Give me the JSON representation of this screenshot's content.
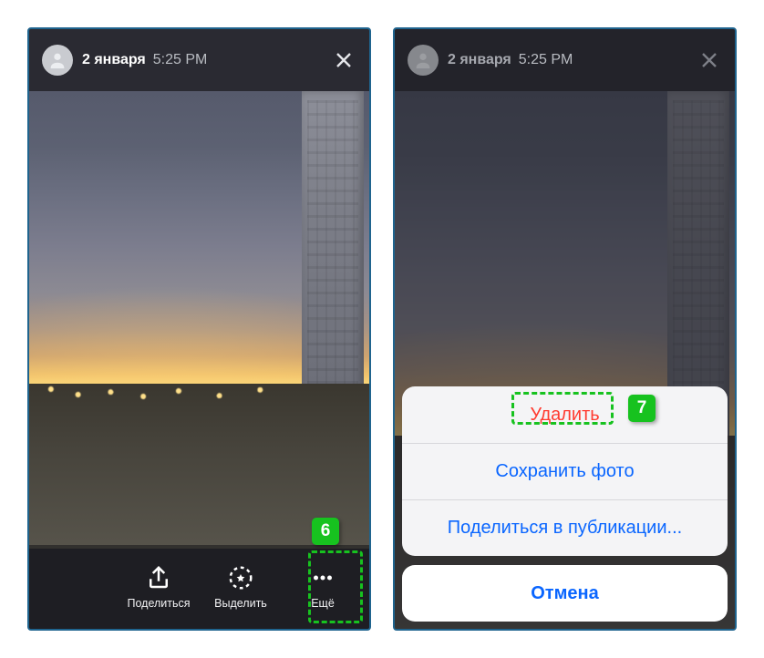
{
  "header": {
    "date": "2 января",
    "time": "5:25 PM"
  },
  "left": {
    "share_label": "Поделиться",
    "highlight_label": "Выделить",
    "more_label": "Ещё"
  },
  "sheet": {
    "delete": "Удалить",
    "save": "Сохранить фото",
    "share_post": "Поделиться в публикации...",
    "cancel": "Отмена"
  },
  "annotations": {
    "step6": "6",
    "step7": "7"
  }
}
